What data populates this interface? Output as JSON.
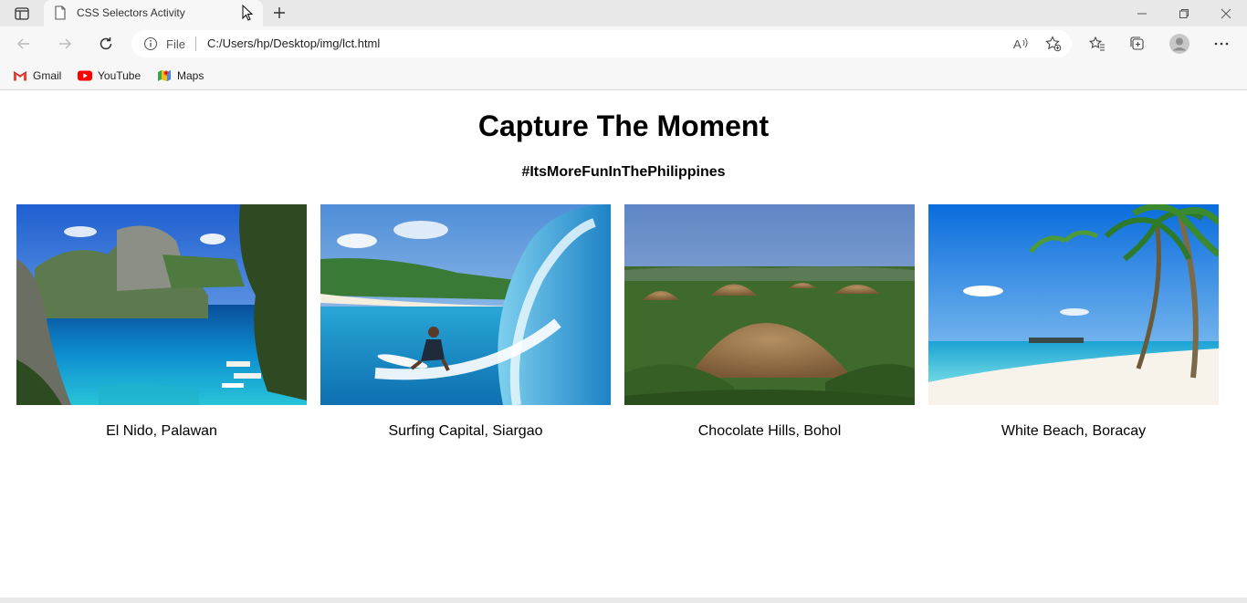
{
  "browser": {
    "tab_title": "CSS Selectors Activity",
    "address_scheme": "File",
    "address_url": "C:/Users/hp/Desktop/img/lct.html",
    "bookmarks": [
      {
        "label": "Gmail",
        "icon": "gmail-icon"
      },
      {
        "label": "YouTube",
        "icon": "youtube-icon"
      },
      {
        "label": "Maps",
        "icon": "maps-icon"
      }
    ]
  },
  "page": {
    "title": "Capture The Moment",
    "subtitle": "#ItsMoreFunInThePhilippines",
    "gallery": [
      {
        "caption": "El Nido, Palawan",
        "image": "lagoon-cliffs-photo"
      },
      {
        "caption": "Surfing Capital, Siargao",
        "image": "surfer-wave-photo"
      },
      {
        "caption": "Chocolate Hills, Bohol",
        "image": "chocolate-hills-photo"
      },
      {
        "caption": "White Beach, Boracay",
        "image": "palm-beach-photo"
      }
    ]
  },
  "colors": {
    "chrome_bg": "#f7f7f7",
    "tabbar_bg": "#e8e8e8",
    "page_bg": "#ffffff",
    "youtube_red": "#ff0000"
  }
}
